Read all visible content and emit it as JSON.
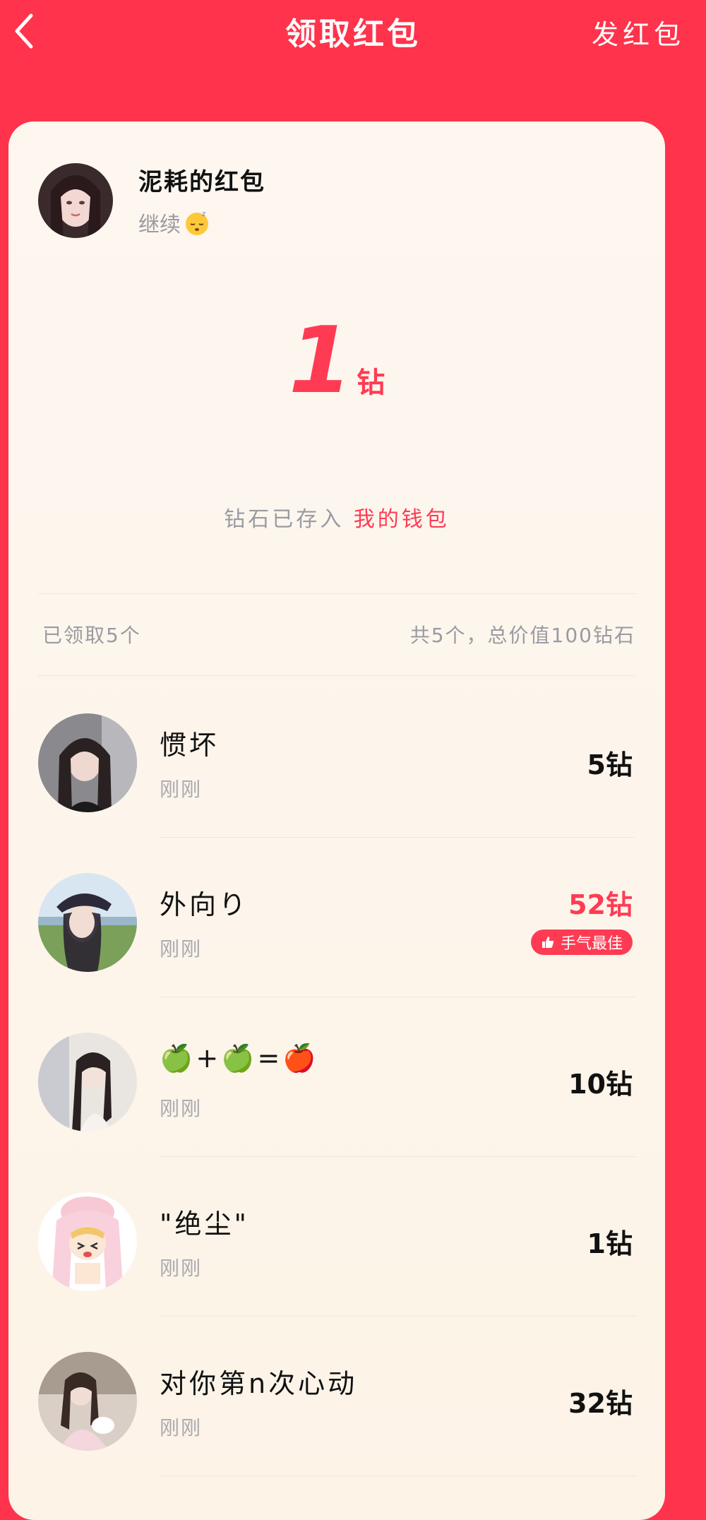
{
  "header": {
    "back_icon": "chevron-left-icon",
    "title": "领取红包",
    "send_label": "发红包"
  },
  "sender": {
    "name": "泥耗的红包",
    "message": "继续",
    "emoji": "sleeping-face-emoji"
  },
  "amount": {
    "value": "1",
    "unit": "钻"
  },
  "wallet": {
    "prefix": "钻石已存入",
    "link": "我的钱包"
  },
  "summary": {
    "received": "已领取5个",
    "total": "共5个，总价值100钻石"
  },
  "receivers": [
    {
      "name": "惯坏",
      "time": "刚刚",
      "amount": "5钻",
      "best": false
    },
    {
      "name": "外向り",
      "time": "刚刚",
      "amount": "52钻",
      "best": true,
      "badge": "手气最佳"
    },
    {
      "name": "🍏+🍏=🍎",
      "time": "刚刚",
      "amount": "10钻",
      "best": false
    },
    {
      "name": "\"绝尘\"",
      "time": "刚刚",
      "amount": "1钻",
      "best": false
    },
    {
      "name": "对你第n次心动",
      "time": "刚刚",
      "amount": "32钻",
      "best": false
    }
  ],
  "colors": {
    "brand_red": "#ff334b",
    "accent_red": "#ff3b53",
    "card_bg": "#fdf5eb",
    "muted_text": "#9a9aa2"
  }
}
